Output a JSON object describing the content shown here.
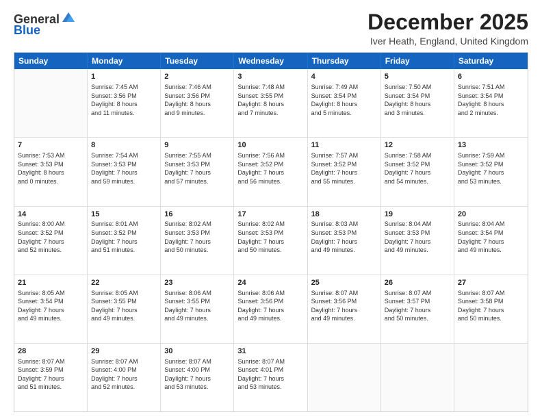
{
  "logo": {
    "general": "General",
    "blue": "Blue"
  },
  "title": "December 2025",
  "location": "Iver Heath, England, United Kingdom",
  "header_days": [
    "Sunday",
    "Monday",
    "Tuesday",
    "Wednesday",
    "Thursday",
    "Friday",
    "Saturday"
  ],
  "rows": [
    [
      {
        "day": "",
        "lines": []
      },
      {
        "day": "1",
        "lines": [
          "Sunrise: 7:45 AM",
          "Sunset: 3:56 PM",
          "Daylight: 8 hours",
          "and 11 minutes."
        ]
      },
      {
        "day": "2",
        "lines": [
          "Sunrise: 7:46 AM",
          "Sunset: 3:56 PM",
          "Daylight: 8 hours",
          "and 9 minutes."
        ]
      },
      {
        "day": "3",
        "lines": [
          "Sunrise: 7:48 AM",
          "Sunset: 3:55 PM",
          "Daylight: 8 hours",
          "and 7 minutes."
        ]
      },
      {
        "day": "4",
        "lines": [
          "Sunrise: 7:49 AM",
          "Sunset: 3:54 PM",
          "Daylight: 8 hours",
          "and 5 minutes."
        ]
      },
      {
        "day": "5",
        "lines": [
          "Sunrise: 7:50 AM",
          "Sunset: 3:54 PM",
          "Daylight: 8 hours",
          "and 3 minutes."
        ]
      },
      {
        "day": "6",
        "lines": [
          "Sunrise: 7:51 AM",
          "Sunset: 3:54 PM",
          "Daylight: 8 hours",
          "and 2 minutes."
        ]
      }
    ],
    [
      {
        "day": "7",
        "lines": [
          "Sunrise: 7:53 AM",
          "Sunset: 3:53 PM",
          "Daylight: 8 hours",
          "and 0 minutes."
        ]
      },
      {
        "day": "8",
        "lines": [
          "Sunrise: 7:54 AM",
          "Sunset: 3:53 PM",
          "Daylight: 7 hours",
          "and 59 minutes."
        ]
      },
      {
        "day": "9",
        "lines": [
          "Sunrise: 7:55 AM",
          "Sunset: 3:53 PM",
          "Daylight: 7 hours",
          "and 57 minutes."
        ]
      },
      {
        "day": "10",
        "lines": [
          "Sunrise: 7:56 AM",
          "Sunset: 3:52 PM",
          "Daylight: 7 hours",
          "and 56 minutes."
        ]
      },
      {
        "day": "11",
        "lines": [
          "Sunrise: 7:57 AM",
          "Sunset: 3:52 PM",
          "Daylight: 7 hours",
          "and 55 minutes."
        ]
      },
      {
        "day": "12",
        "lines": [
          "Sunrise: 7:58 AM",
          "Sunset: 3:52 PM",
          "Daylight: 7 hours",
          "and 54 minutes."
        ]
      },
      {
        "day": "13",
        "lines": [
          "Sunrise: 7:59 AM",
          "Sunset: 3:52 PM",
          "Daylight: 7 hours",
          "and 53 minutes."
        ]
      }
    ],
    [
      {
        "day": "14",
        "lines": [
          "Sunrise: 8:00 AM",
          "Sunset: 3:52 PM",
          "Daylight: 7 hours",
          "and 52 minutes."
        ]
      },
      {
        "day": "15",
        "lines": [
          "Sunrise: 8:01 AM",
          "Sunset: 3:52 PM",
          "Daylight: 7 hours",
          "and 51 minutes."
        ]
      },
      {
        "day": "16",
        "lines": [
          "Sunrise: 8:02 AM",
          "Sunset: 3:53 PM",
          "Daylight: 7 hours",
          "and 50 minutes."
        ]
      },
      {
        "day": "17",
        "lines": [
          "Sunrise: 8:02 AM",
          "Sunset: 3:53 PM",
          "Daylight: 7 hours",
          "and 50 minutes."
        ]
      },
      {
        "day": "18",
        "lines": [
          "Sunrise: 8:03 AM",
          "Sunset: 3:53 PM",
          "Daylight: 7 hours",
          "and 49 minutes."
        ]
      },
      {
        "day": "19",
        "lines": [
          "Sunrise: 8:04 AM",
          "Sunset: 3:53 PM",
          "Daylight: 7 hours",
          "and 49 minutes."
        ]
      },
      {
        "day": "20",
        "lines": [
          "Sunrise: 8:04 AM",
          "Sunset: 3:54 PM",
          "Daylight: 7 hours",
          "and 49 minutes."
        ]
      }
    ],
    [
      {
        "day": "21",
        "lines": [
          "Sunrise: 8:05 AM",
          "Sunset: 3:54 PM",
          "Daylight: 7 hours",
          "and 49 minutes."
        ]
      },
      {
        "day": "22",
        "lines": [
          "Sunrise: 8:05 AM",
          "Sunset: 3:55 PM",
          "Daylight: 7 hours",
          "and 49 minutes."
        ]
      },
      {
        "day": "23",
        "lines": [
          "Sunrise: 8:06 AM",
          "Sunset: 3:55 PM",
          "Daylight: 7 hours",
          "and 49 minutes."
        ]
      },
      {
        "day": "24",
        "lines": [
          "Sunrise: 8:06 AM",
          "Sunset: 3:56 PM",
          "Daylight: 7 hours",
          "and 49 minutes."
        ]
      },
      {
        "day": "25",
        "lines": [
          "Sunrise: 8:07 AM",
          "Sunset: 3:56 PM",
          "Daylight: 7 hours",
          "and 49 minutes."
        ]
      },
      {
        "day": "26",
        "lines": [
          "Sunrise: 8:07 AM",
          "Sunset: 3:57 PM",
          "Daylight: 7 hours",
          "and 50 minutes."
        ]
      },
      {
        "day": "27",
        "lines": [
          "Sunrise: 8:07 AM",
          "Sunset: 3:58 PM",
          "Daylight: 7 hours",
          "and 50 minutes."
        ]
      }
    ],
    [
      {
        "day": "28",
        "lines": [
          "Sunrise: 8:07 AM",
          "Sunset: 3:59 PM",
          "Daylight: 7 hours",
          "and 51 minutes."
        ]
      },
      {
        "day": "29",
        "lines": [
          "Sunrise: 8:07 AM",
          "Sunset: 4:00 PM",
          "Daylight: 7 hours",
          "and 52 minutes."
        ]
      },
      {
        "day": "30",
        "lines": [
          "Sunrise: 8:07 AM",
          "Sunset: 4:00 PM",
          "Daylight: 7 hours",
          "and 53 minutes."
        ]
      },
      {
        "day": "31",
        "lines": [
          "Sunrise: 8:07 AM",
          "Sunset: 4:01 PM",
          "Daylight: 7 hours",
          "and 53 minutes."
        ]
      },
      {
        "day": "",
        "lines": []
      },
      {
        "day": "",
        "lines": []
      },
      {
        "day": "",
        "lines": []
      }
    ]
  ]
}
